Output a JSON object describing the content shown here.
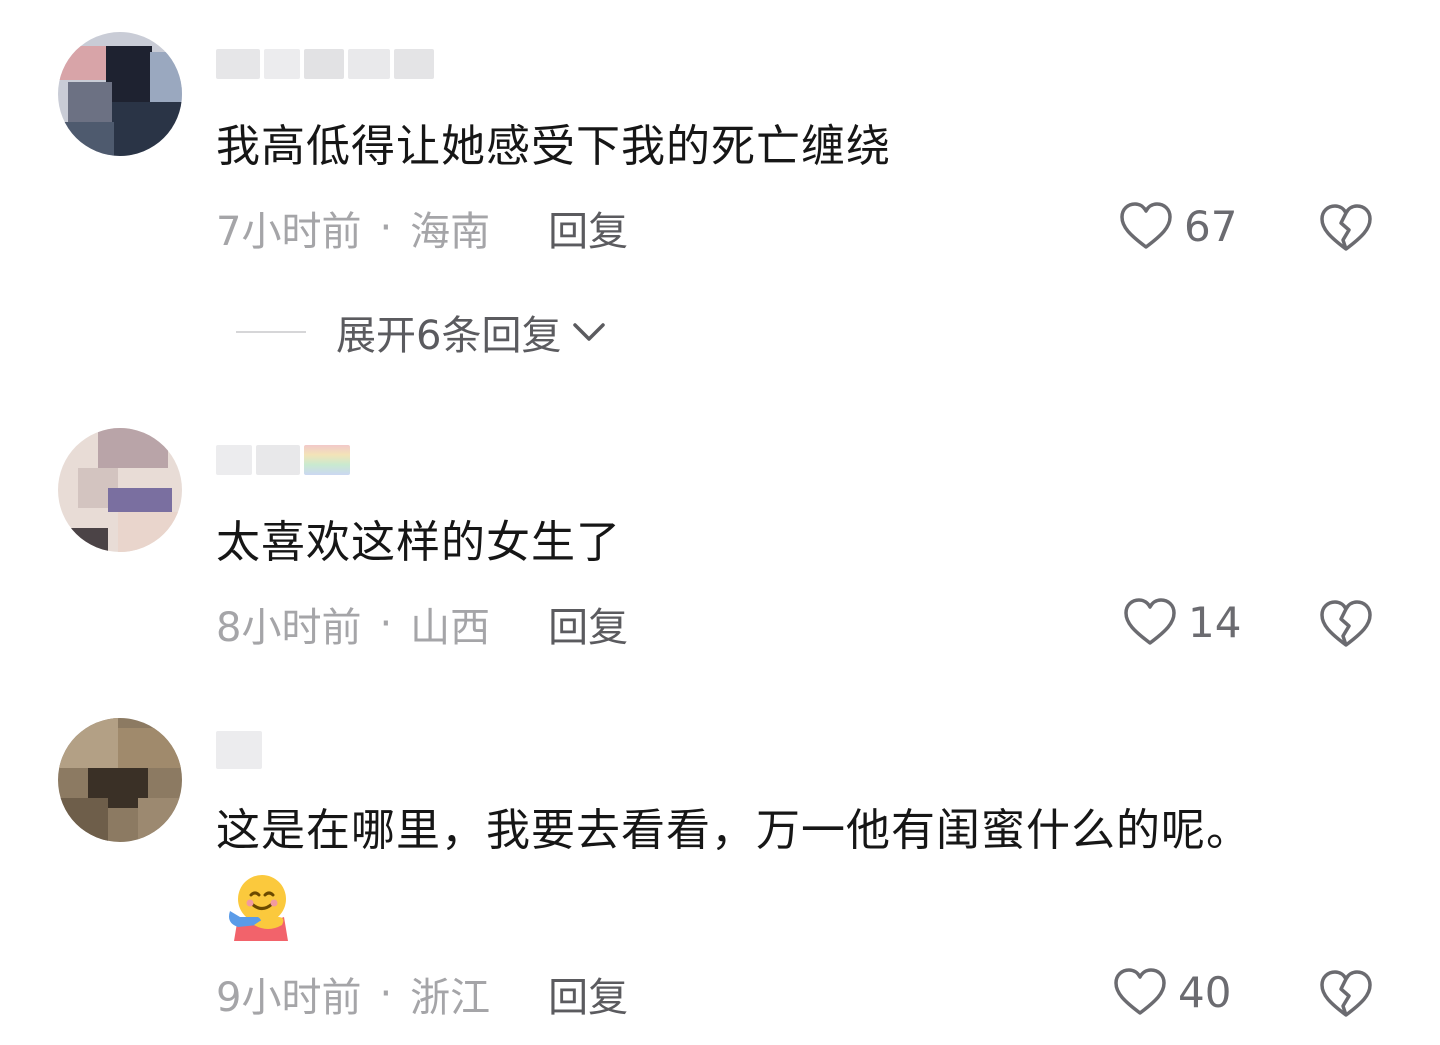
{
  "comments": [
    {
      "content": "我高低得让她感受下我的死亡缠绕",
      "time": "7小时前",
      "separator": "·",
      "location": "海南",
      "reply_label": "回复",
      "like_count": "67",
      "expand_label": "展开6条回复"
    },
    {
      "content": "太喜欢这样的女生了",
      "time": "8小时前",
      "separator": "·",
      "location": "山西",
      "reply_label": "回复",
      "like_count": "14"
    },
    {
      "content": "这是在哪里，我要去看看，万一他有闺蜜什么的呢。",
      "emoji": "hugging-face",
      "time": "9小时前",
      "separator": "·",
      "location": "浙江",
      "reply_label": "回复",
      "like_count": "40"
    }
  ],
  "icons": {
    "like": "heart-outline-icon",
    "dislike": "broken-heart-icon",
    "expand": "chevron-down-icon"
  },
  "colors": {
    "text_primary": "#161616",
    "text_meta": "#a5a5a8",
    "text_action": "#5b5b5f",
    "icon": "#6b6b70"
  }
}
